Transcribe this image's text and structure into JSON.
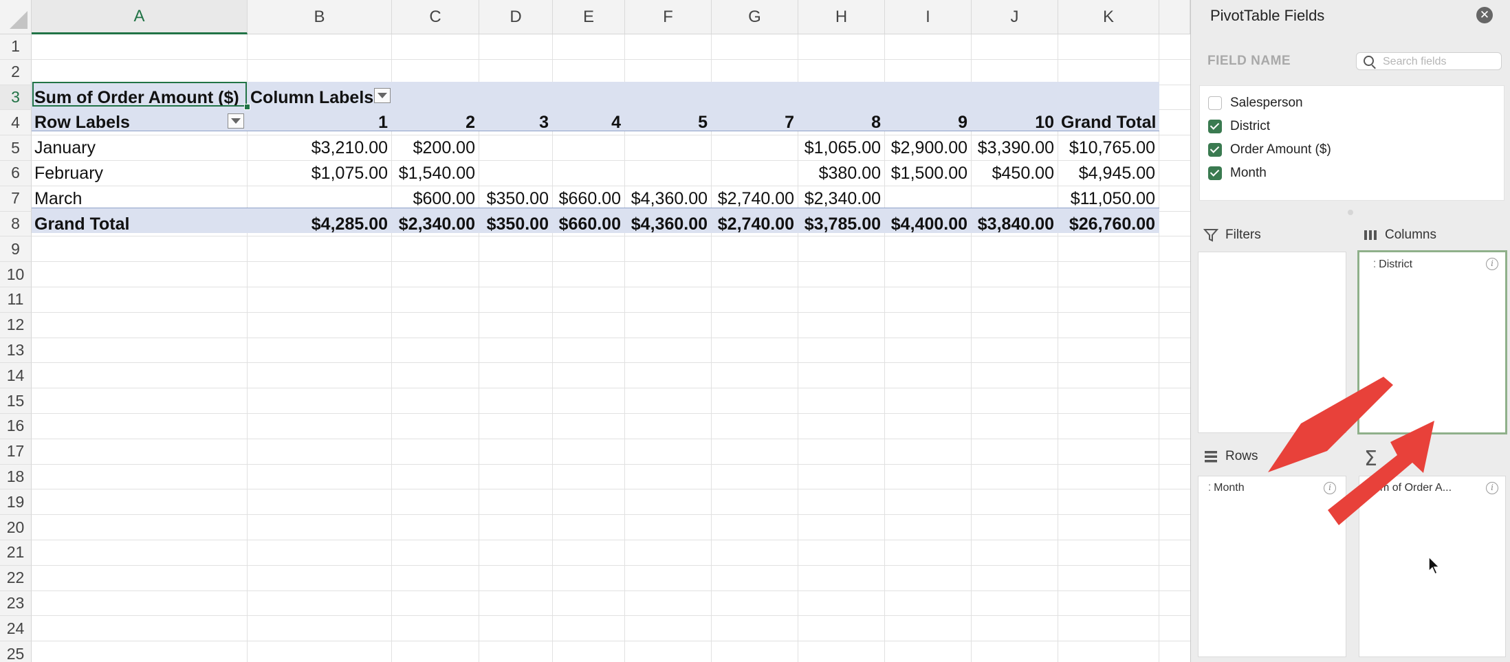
{
  "sheet": {
    "columns": [
      "A",
      "B",
      "C",
      "D",
      "E",
      "F",
      "G",
      "H",
      "I",
      "J",
      "K"
    ],
    "rows": [
      "1",
      "2",
      "3",
      "4",
      "5",
      "6",
      "7",
      "8",
      "9",
      "10",
      "11",
      "12",
      "13",
      "14",
      "15",
      "16",
      "17",
      "18",
      "19",
      "20",
      "21",
      "22",
      "23",
      "24",
      "25"
    ],
    "active_column": "A",
    "active_row": "3"
  },
  "pivot": {
    "values_header": "Sum of Order Amount ($)",
    "column_labels": "Column Labels",
    "row_labels": "Row Labels",
    "district_headers": [
      "1",
      "2",
      "3",
      "4",
      "5",
      "7",
      "8",
      "9",
      "10"
    ],
    "grand_total_header": "Grand Total",
    "rows": [
      {
        "label": "January",
        "values": [
          "$3,210.00",
          "$200.00",
          "",
          "",
          "",
          "",
          "$1,065.00",
          "$2,900.00",
          "$3,390.00"
        ],
        "total": "$10,765.00"
      },
      {
        "label": "February",
        "values": [
          "$1,075.00",
          "$1,540.00",
          "",
          "",
          "",
          "",
          "$380.00",
          "$1,500.00",
          "$450.00"
        ],
        "total": "$4,945.00"
      },
      {
        "label": "March",
        "values": [
          "",
          "$600.00",
          "$350.00",
          "$660.00",
          "$4,360.00",
          "$2,740.00",
          "$2,340.00",
          "",
          ""
        ],
        "total": "$11,050.00"
      }
    ],
    "grand_total": {
      "label": "Grand Total",
      "values": [
        "$4,285.00",
        "$2,340.00",
        "$350.00",
        "$660.00",
        "$4,360.00",
        "$2,740.00",
        "$3,785.00",
        "$4,400.00",
        "$3,840.00"
      ],
      "total": "$26,760.00"
    }
  },
  "panel": {
    "title": "PivotTable Fields",
    "close_glyph": "✕",
    "field_name_label": "FIELD NAME",
    "search_placeholder": "Search fields",
    "fields": [
      {
        "label": "Salesperson",
        "checked": false
      },
      {
        "label": "District",
        "checked": true
      },
      {
        "label": "Order Amount ($)",
        "checked": true
      },
      {
        "label": "Month",
        "checked": true
      }
    ],
    "areas": {
      "filters": {
        "label": "Filters",
        "items": []
      },
      "columns": {
        "label": "Columns",
        "items": [
          "District"
        ]
      },
      "rows": {
        "label": "Rows",
        "items": [
          "Month"
        ]
      },
      "values": {
        "label": "Values",
        "items": [
          "Sum of Order A..."
        ],
        "visible_item_text": "m of Order A..."
      }
    },
    "info_glyph": "i",
    "accent_green": "#217346",
    "arrow_color": "#e8413a",
    "highlight_border": "#8fb08a"
  }
}
